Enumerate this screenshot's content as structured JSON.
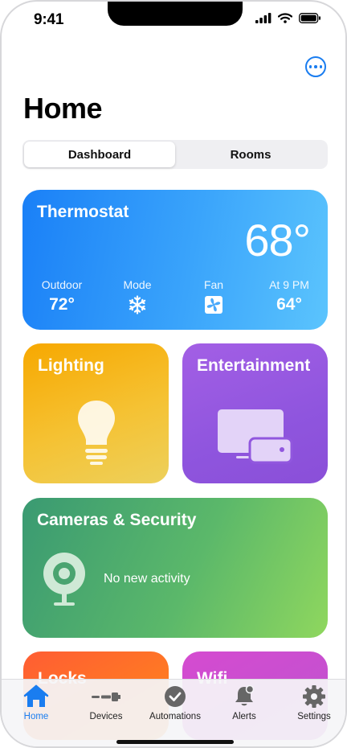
{
  "status_bar": {
    "time": "9:41"
  },
  "header": {
    "title": "Home",
    "more_icon": "ellipsis-circle-icon"
  },
  "segments": [
    {
      "label": "Dashboard",
      "selected": true
    },
    {
      "label": "Rooms",
      "selected": false
    }
  ],
  "thermostat": {
    "title": "Thermostat",
    "current_temp": "68°",
    "stats": [
      {
        "label": "Outdoor",
        "value": "72°"
      },
      {
        "label": "Mode",
        "icon": "snowflake-icon"
      },
      {
        "label": "Fan",
        "icon": "fan-icon"
      },
      {
        "label": "At 9 PM",
        "value": "64°"
      }
    ]
  },
  "lighting": {
    "title": "Lighting",
    "icon": "lightbulb-icon"
  },
  "entertainment": {
    "title": "Entertainment",
    "icon": "tv-remote-icon"
  },
  "cameras": {
    "title": "Cameras & Security",
    "status": "No new activity",
    "icon": "security-camera-icon"
  },
  "locks": {
    "title": "Locks"
  },
  "wifi": {
    "title": "Wifi"
  },
  "tab_bar": {
    "tabs": [
      {
        "label": "Home",
        "icon": "house-icon",
        "active": true
      },
      {
        "label": "Devices",
        "icon": "devices-plug-icon",
        "active": false
      },
      {
        "label": "Automations",
        "icon": "clock-check-icon",
        "active": false
      },
      {
        "label": "Alerts",
        "icon": "bell-icon",
        "active": false
      },
      {
        "label": "Settings",
        "icon": "gear-icon",
        "active": false
      }
    ]
  },
  "colors": {
    "accent": "#1a7df0",
    "thermostat": "#1a80f7",
    "lighting": "#f7a800",
    "entertainment": "#9a58e2",
    "cameras": "#5bb86a",
    "locks": "#ff6a2a",
    "wifi": "#cf4ed0"
  }
}
